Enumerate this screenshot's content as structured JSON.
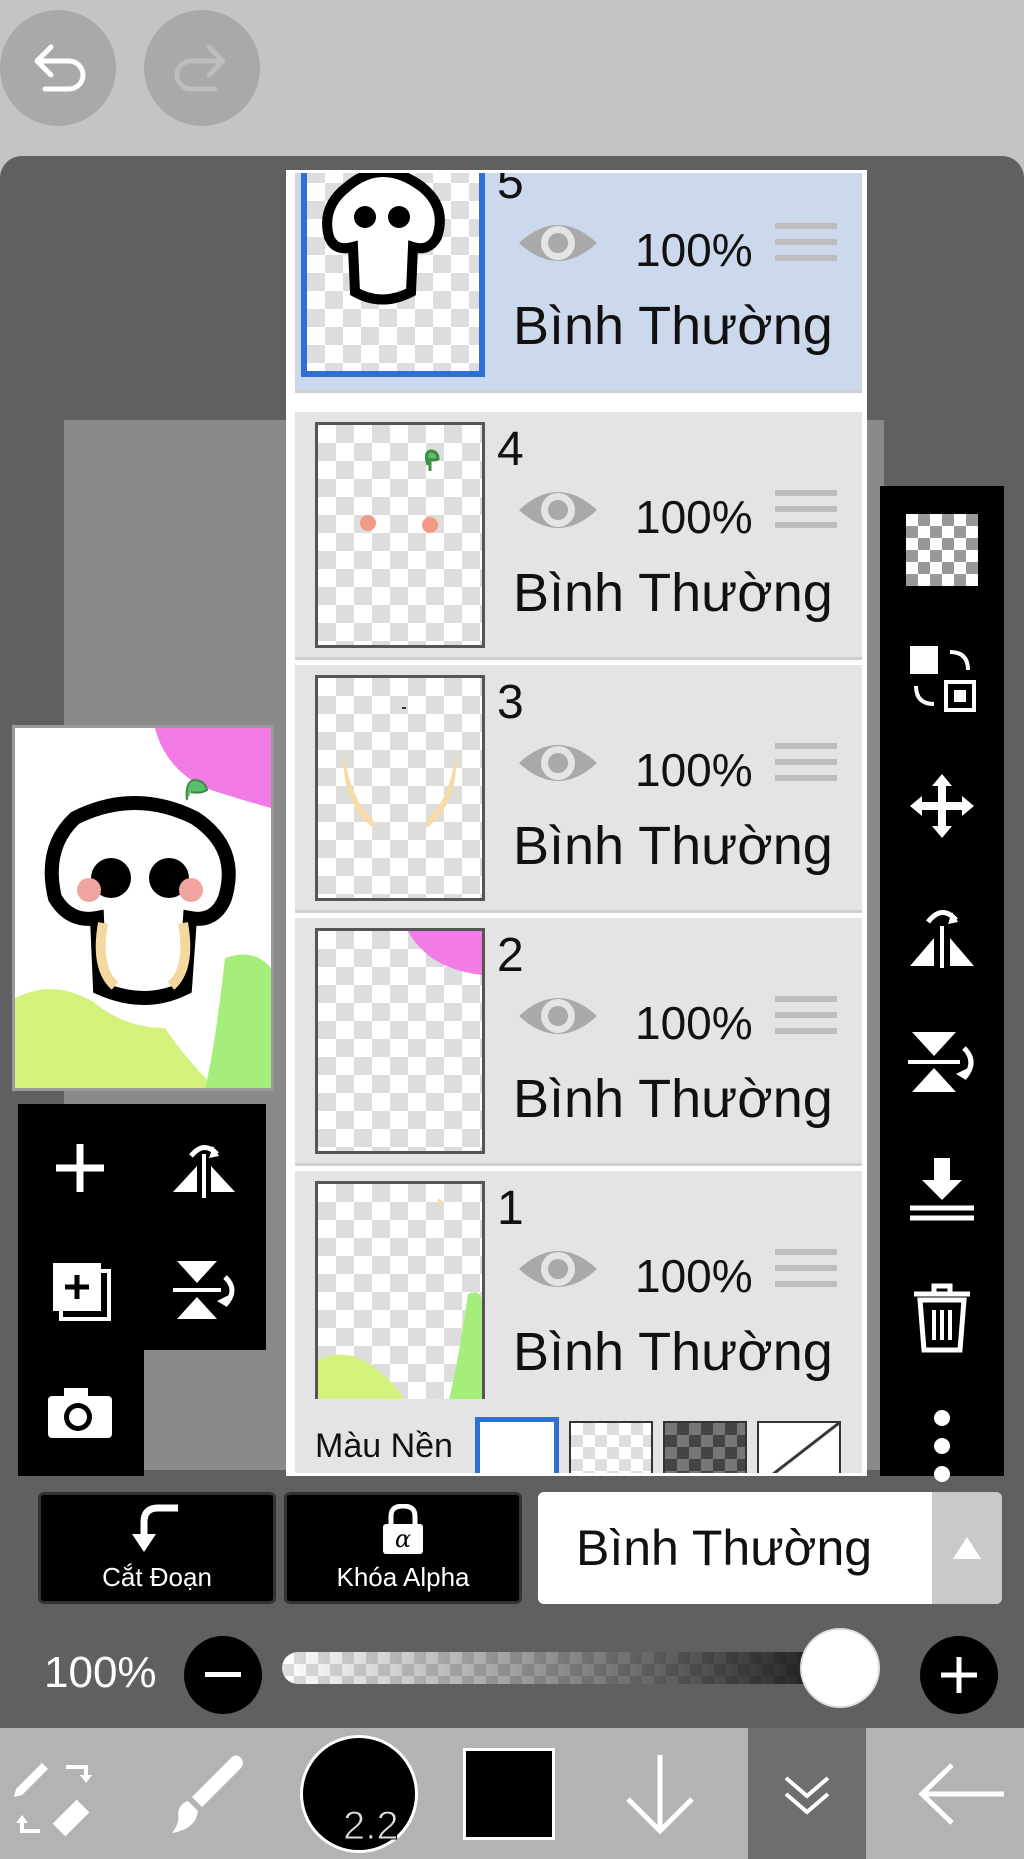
{
  "layers": [
    {
      "number": "5",
      "opacity": "100%",
      "blend": "Bình Thường",
      "selected": true
    },
    {
      "number": "4",
      "opacity": "100%",
      "blend": "Bình Thường",
      "selected": false
    },
    {
      "number": "3",
      "opacity": "100%",
      "blend": "Bình Thường",
      "selected": false
    },
    {
      "number": "2",
      "opacity": "100%",
      "blend": "Bình Thường",
      "selected": false
    },
    {
      "number": "1",
      "opacity": "100%",
      "blend": "Bình Thường",
      "selected": false
    }
  ],
  "background_row": {
    "label": "Màu Nền"
  },
  "actions": {
    "clip_label": "Cắt Đoạn",
    "alpha_lock_label": "Khóa Alpha"
  },
  "blend_mode": {
    "value": "Bình Thường"
  },
  "opacity_control": {
    "value_label": "100%",
    "level": 1.0
  },
  "brush": {
    "size_label": "2.2"
  },
  "colors": {
    "accent": "#2f6fd6",
    "selected_row": "#ccd9ec",
    "primary_color": "#000000"
  },
  "icons": {
    "undo": "undo-icon",
    "redo": "redo-icon",
    "add_layer": "plus-icon",
    "flip": "flip-horizontal-icon",
    "duplicate": "duplicate-layer-icon",
    "camera": "camera-icon",
    "checker": "transparent-icon",
    "move": "move-icon",
    "trash": "trash-icon",
    "more": "more-vertical-icon"
  }
}
